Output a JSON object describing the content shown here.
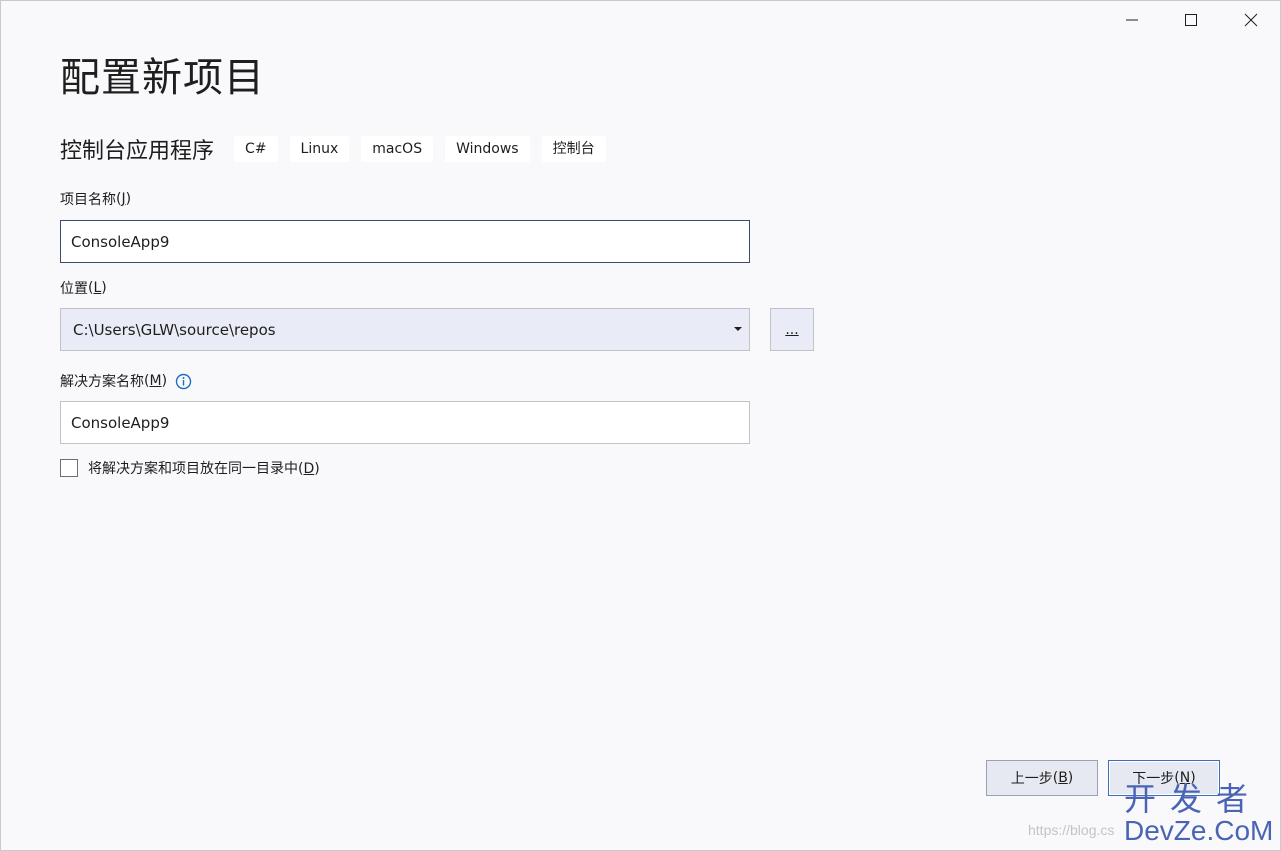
{
  "window": {
    "controls": [
      "minimize-icon",
      "maximize-icon",
      "close-icon"
    ]
  },
  "title": "配置新项目",
  "template": {
    "name": "控制台应用程序",
    "tags": [
      "C#",
      "Linux",
      "macOS",
      "Windows",
      "控制台"
    ]
  },
  "project_name": {
    "label": "项目名称",
    "accel_prefix": "(",
    "accel": "J",
    "accel_suffix": ")",
    "value": "ConsoleApp9"
  },
  "location": {
    "label": "位置",
    "accel_prefix": "(",
    "accel": "L",
    "accel_suffix": ")",
    "value": "C:\\Users\\GLW\\source\\repos",
    "browse_label": "..."
  },
  "solution_name": {
    "label": "解决方案名称",
    "accel_prefix": "(",
    "accel": "M",
    "accel_suffix": ")",
    "value": "ConsoleApp9",
    "info_icon": "info-icon"
  },
  "same_directory": {
    "label": "将解决方案和项目放在同一目录中",
    "accel_prefix": "(",
    "accel": "D",
    "accel_suffix": ")",
    "checked": false
  },
  "buttons": {
    "back": {
      "label": "上一步",
      "accel_prefix": "(",
      "accel": "B",
      "accel_suffix": ")"
    },
    "next": {
      "label": "下一步",
      "accel_prefix": "(",
      "accel": "N",
      "accel_suffix": ")"
    }
  },
  "watermark": {
    "url": "https://blog.cs",
    "logo_cn": "开发者",
    "logo_en": "DevZe.CoM"
  },
  "colors": {
    "background": "#f9f9fb",
    "accent": "#3c6fb6",
    "info": "#1a6fc6",
    "watermark": "#4a64b5"
  }
}
